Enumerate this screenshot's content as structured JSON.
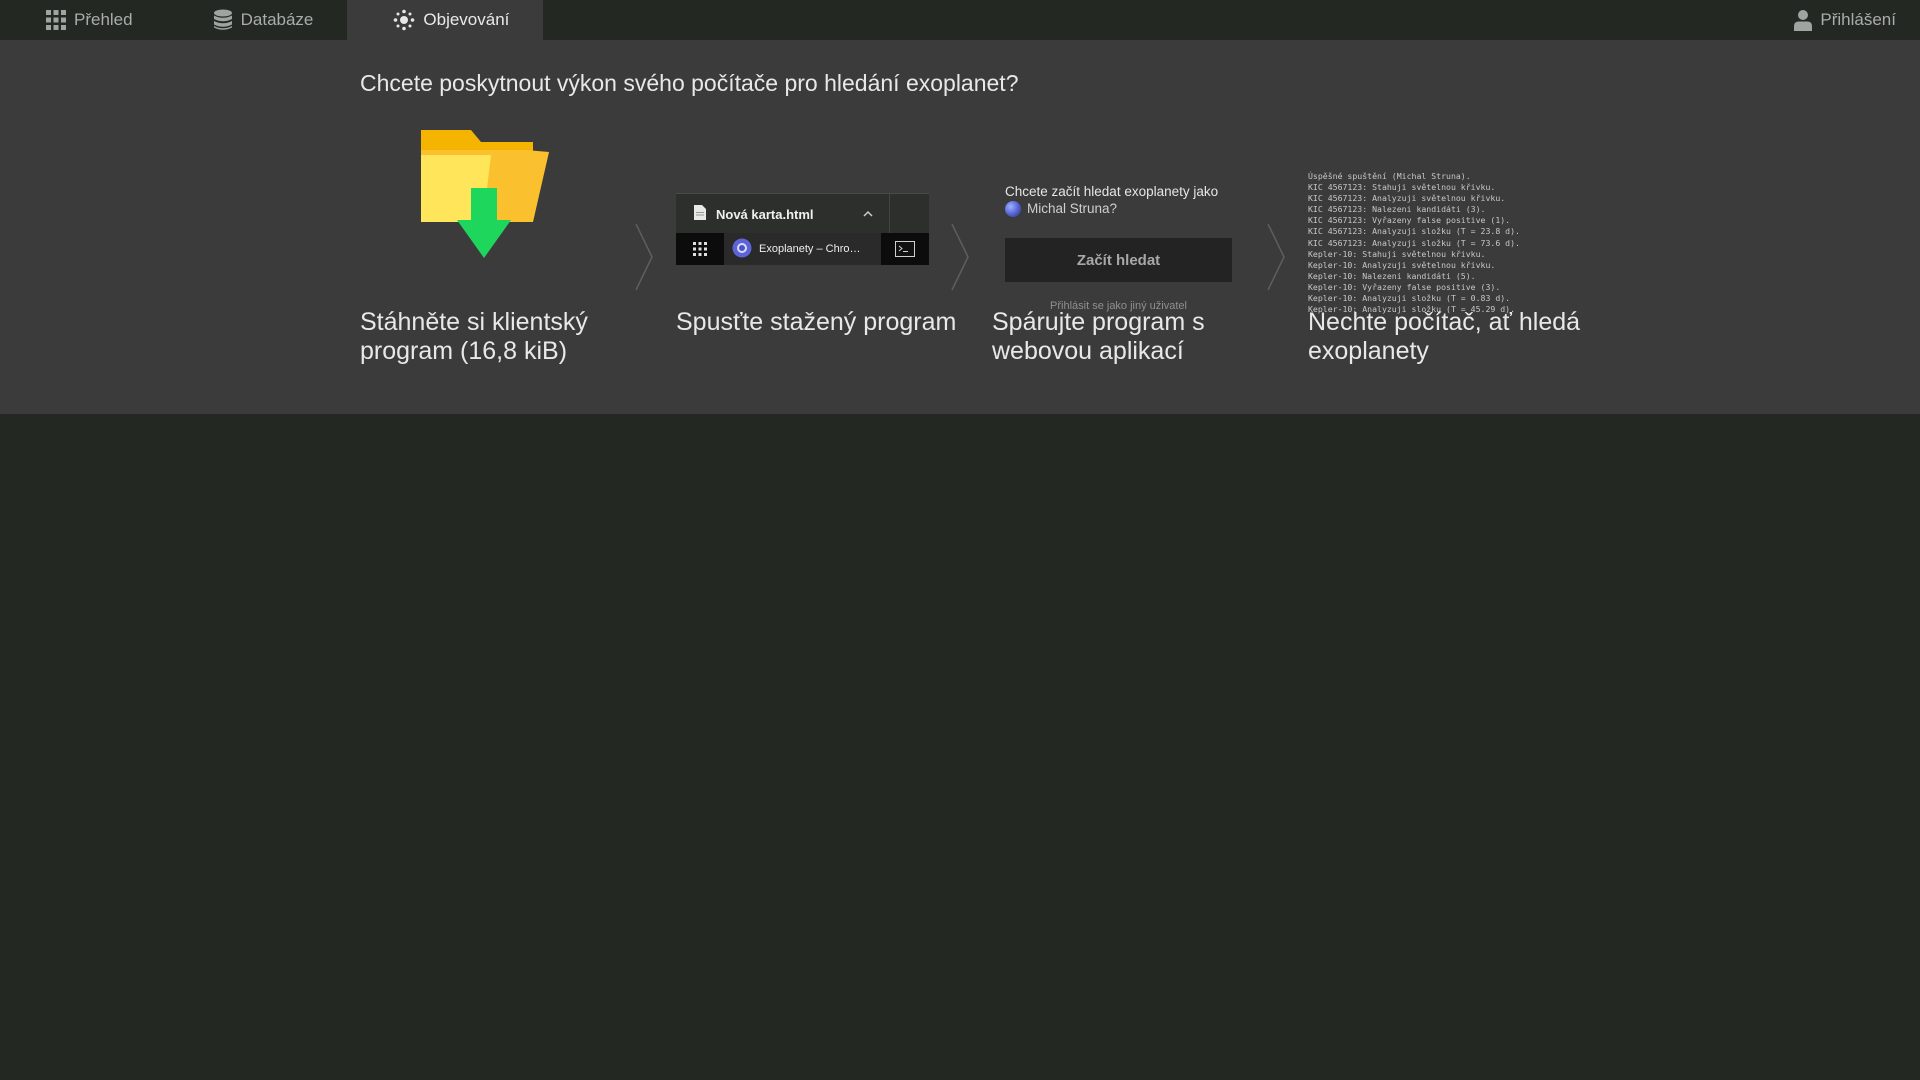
{
  "nav": {
    "items": [
      {
        "label": "Přehled",
        "icon": "grid-icon",
        "active": false
      },
      {
        "label": "Databáze",
        "icon": "database-icon",
        "active": false
      },
      {
        "label": "Objevování",
        "icon": "discovery-icon",
        "active": true
      }
    ],
    "login_label": "Přihlášení",
    "login_icon": "user-icon"
  },
  "main": {
    "question": "Chcete poskytnout výkon svého počítače pro hledání exoplanet?",
    "steps": [
      {
        "caption": "Stáhněte si klientský program (16,8 kiB)",
        "icon": "folder-download-icon"
      },
      {
        "caption": "Spusťte stažený program"
      },
      {
        "caption": "Spárujte program s webovou aplikací"
      },
      {
        "caption": "Nechte počítač, ať hledá exoplanety"
      }
    ],
    "download_mock": {
      "file_name": "Nová karta.html",
      "taskbar_window": "Exoplanety – Chro…"
    },
    "pairing_mock": {
      "question": "Chcete začít hledat exoplanety jako",
      "user_name": "Michal Struna?",
      "start_button": "Začít hledat",
      "other_user_link": "Přihlásit se jako jiný uživatel"
    },
    "console_lines": [
      "Úspěšné spuštění (Michal Struna).",
      "KIC 4567123: Stahuji světelnou křivku.",
      "KIC 4567123: Analyzuji světelnou křivku.",
      "KIC 4567123: Nalezeni kandidáti (3).",
      "KIC 4567123: Vyřazeny false positive (1).",
      "KIC 4567123: Analyzuji složku (T = 23.8 d).",
      "KIC 4567123: Analyzuji složku (T = 73.6 d).",
      "Kepler-10: Stahuji světelnou křivku.",
      "Kepler-10: Analyzuji světelnou křivku.",
      "Kepler-10: Nalezeni kandidáti (5).",
      "Kepler-10: Vyřazeny false positive (3).",
      "Kepler-10: Analyzuji složku (T = 0.83 d).",
      "Kepler-10: Analyzuji složku (T = 45.29 d)."
    ]
  }
}
